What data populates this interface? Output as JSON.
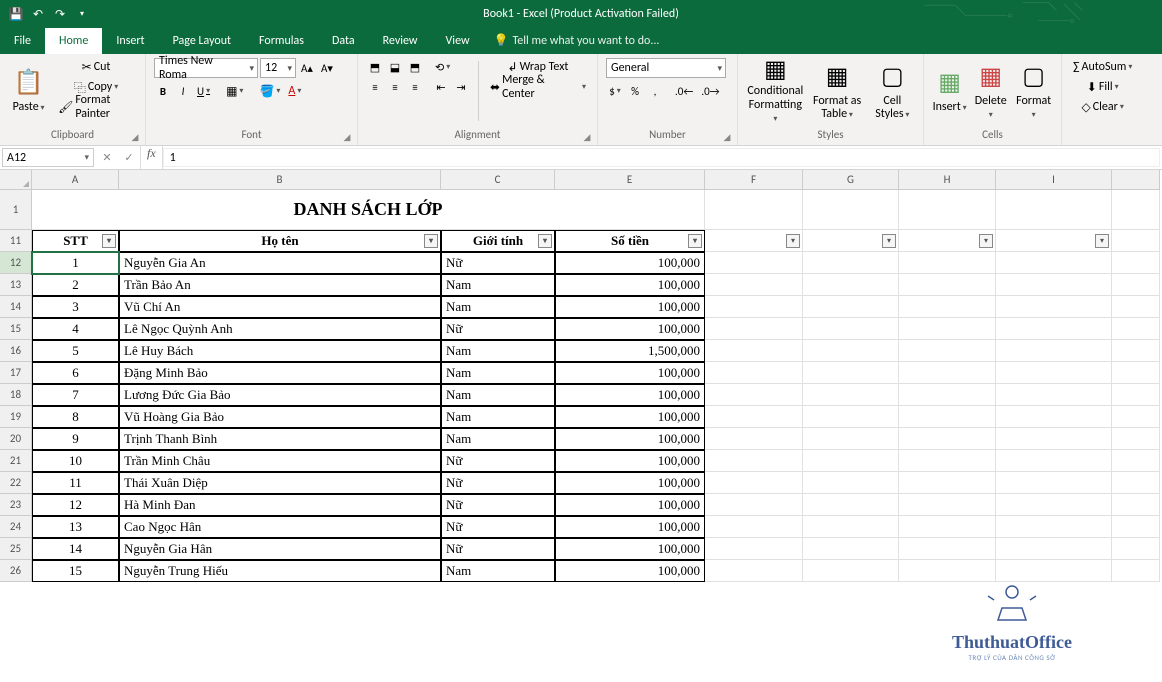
{
  "app": {
    "title": "Book1 - Excel (Product Activation Failed)"
  },
  "tabs": {
    "file": "File",
    "home": "Home",
    "insert": "Insert",
    "pagelayout": "Page Layout",
    "formulas": "Formulas",
    "data": "Data",
    "review": "Review",
    "view": "View",
    "tellme": "Tell me what you want to do..."
  },
  "ribbon": {
    "clipboard": {
      "paste": "Paste",
      "cut": "Cut",
      "copy": "Copy",
      "painter": "Format Painter",
      "label": "Clipboard"
    },
    "font": {
      "name": "Times New Roma",
      "size": "12",
      "label": "Font"
    },
    "alignment": {
      "wrap": "Wrap Text",
      "merge": "Merge & Center",
      "label": "Alignment"
    },
    "number": {
      "format": "General",
      "label": "Number"
    },
    "styles": {
      "cond": "Conditional Formatting",
      "table": "Format as Table",
      "cell": "Cell Styles",
      "label": "Styles"
    },
    "cells": {
      "insert": "Insert",
      "delete": "Delete",
      "format": "Format",
      "label": "Cells"
    },
    "editing": {
      "sum": "AutoSum",
      "fill": "Fill",
      "clear": "Clear"
    }
  },
  "namebox": "A12",
  "formula": "1",
  "cols": [
    "A",
    "B",
    "C",
    "E",
    "F",
    "G",
    "H",
    "I"
  ],
  "sheet": {
    "title": "DANH SÁCH LỚP",
    "headers": {
      "stt": "STT",
      "hoten": "Họ tên",
      "gioitinh": "Giới tính",
      "sotien": "Số tiền"
    },
    "rows": [
      {
        "n": 12,
        "stt": "1",
        "hoten": "Nguyễn Gia An",
        "gt": "Nữ",
        "st": "100,000"
      },
      {
        "n": 13,
        "stt": "2",
        "hoten": "Trần Bảo An",
        "gt": "Nam",
        "st": "100,000"
      },
      {
        "n": 14,
        "stt": "3",
        "hoten": "Vũ Chí An",
        "gt": "Nam",
        "st": "100,000"
      },
      {
        "n": 15,
        "stt": "4",
        "hoten": "Lê Ngọc Quỳnh Anh",
        "gt": "Nữ",
        "st": "100,000"
      },
      {
        "n": 16,
        "stt": "5",
        "hoten": "Lê Huy Bách",
        "gt": "Nam",
        "st": "1,500,000"
      },
      {
        "n": 17,
        "stt": "6",
        "hoten": "Đặng Minh Bảo",
        "gt": "Nam",
        "st": "100,000"
      },
      {
        "n": 18,
        "stt": "7",
        "hoten": "Lương Đức Gia Bảo",
        "gt": "Nam",
        "st": "100,000"
      },
      {
        "n": 19,
        "stt": "8",
        "hoten": "Vũ Hoàng Gia Bảo",
        "gt": "Nam",
        "st": "100,000"
      },
      {
        "n": 20,
        "stt": "9",
        "hoten": "Trịnh Thanh Bình",
        "gt": "Nam",
        "st": "100,000"
      },
      {
        "n": 21,
        "stt": "10",
        "hoten": "Trần Minh Châu",
        "gt": "Nữ",
        "st": "100,000"
      },
      {
        "n": 22,
        "stt": "11",
        "hoten": "Thái Xuân Diệp",
        "gt": "Nữ",
        "st": "100,000"
      },
      {
        "n": 23,
        "stt": "12",
        "hoten": "Hà Minh Đan",
        "gt": "Nữ",
        "st": "100,000"
      },
      {
        "n": 24,
        "stt": "13",
        "hoten": "Cao Ngọc Hân",
        "gt": "Nữ",
        "st": "100,000"
      },
      {
        "n": 25,
        "stt": "14",
        "hoten": "Nguyễn Gia Hân",
        "gt": "Nữ",
        "st": "100,000"
      },
      {
        "n": 26,
        "stt": "15",
        "hoten": "Nguyễn Trung Hiếu",
        "gt": "Nam",
        "st": "100,000"
      }
    ]
  },
  "watermark": {
    "title": "ThuthuatOffice",
    "sub": "TRỢ LÝ CỦA DÂN CÔNG SỞ"
  }
}
